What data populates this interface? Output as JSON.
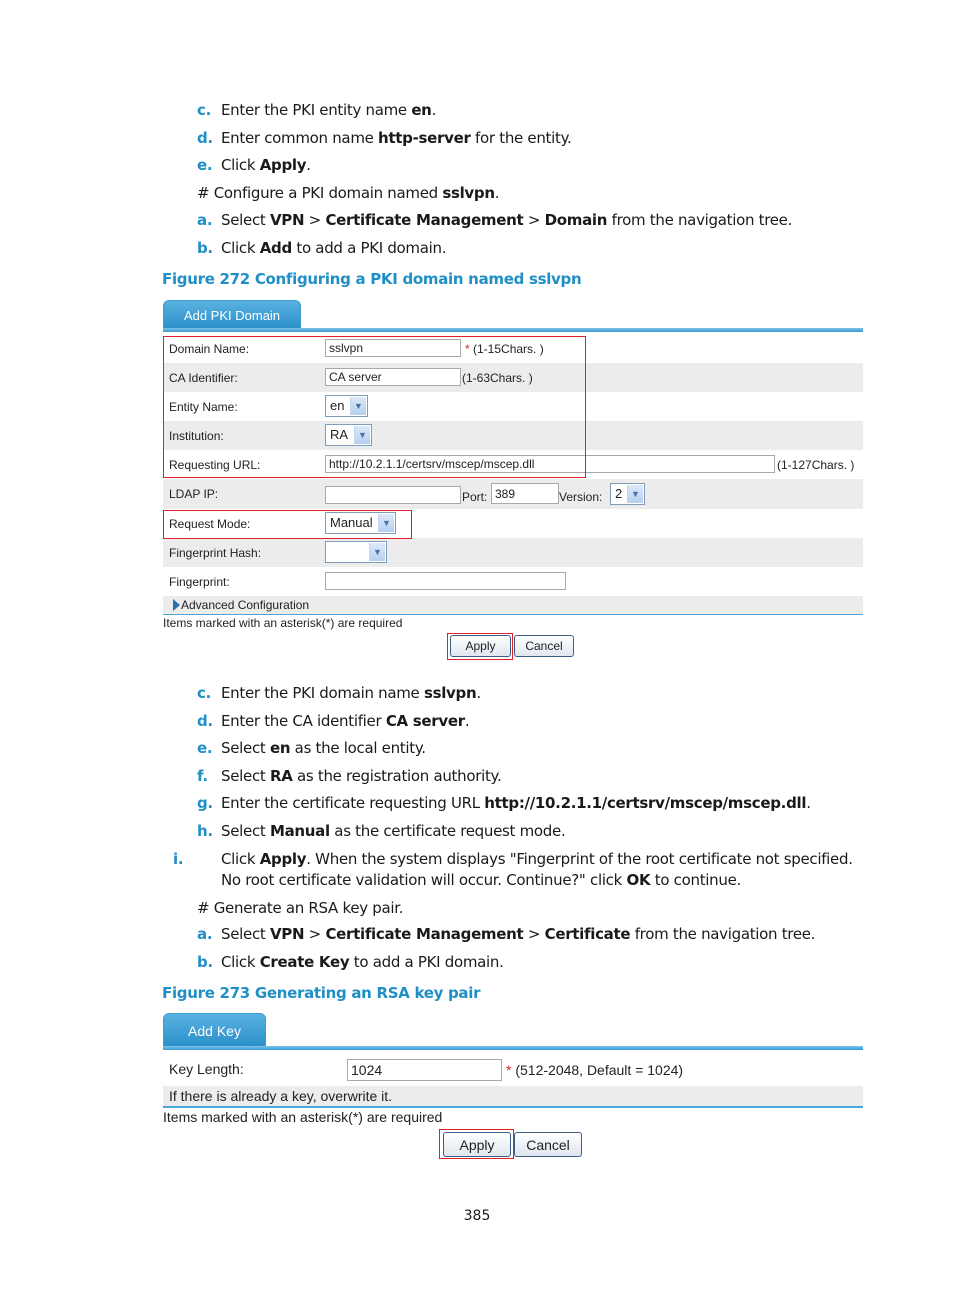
{
  "steps_top": [
    {
      "marker": "c.",
      "pre": "Enter the PKI entity name ",
      "bold": "en",
      "post": "."
    },
    {
      "marker": "d.",
      "pre": "Enter common name ",
      "bold": "http-server",
      "post": " for the entity."
    },
    {
      "marker": "e.",
      "pre": "Click ",
      "bold": "Apply",
      "post": "."
    }
  ],
  "comment_domain": {
    "pre": "# Configure a PKI domain named ",
    "bold": "sslvpn",
    "post": "."
  },
  "steps_domain_nav": [
    {
      "marker": "a.",
      "t1": "Select ",
      "b1": "VPN",
      "t2": " > ",
      "b2": "Certificate Management",
      "t3": " > ",
      "b3": "Domain",
      "t4": " from the navigation tree."
    },
    {
      "marker": "b.",
      "pre": "Click ",
      "bold": "Add",
      "post": " to add a PKI domain."
    }
  ],
  "figure272": {
    "caption": "Figure 272 Configuring a PKI domain named sslvpn",
    "tab_label": "Add PKI Domain",
    "domain_name": {
      "label": "Domain Name:",
      "value": "sslvpn",
      "required_mark": "*",
      "hint": "(1-15Chars. )"
    },
    "ca_identifier": {
      "label": "CA Identifier:",
      "value": "CA server",
      "hint": "(1-63Chars. )"
    },
    "entity_name": {
      "label": "Entity Name:",
      "value": "en"
    },
    "institution": {
      "label": "Institution:",
      "value": "RA"
    },
    "requesting_url": {
      "label": "Requesting URL:",
      "value": "http://10.2.1.1/certsrv/mscep/mscep.dll",
      "hint": "(1-127Chars. )"
    },
    "ldap": {
      "label": "LDAP IP:",
      "value": "",
      "port_label": "Port:",
      "port_value": "389",
      "version_label": "Version:",
      "version_value": "2"
    },
    "request_mode": {
      "label": "Request Mode:",
      "value": "Manual"
    },
    "fingerprint_hash": {
      "label": "Fingerprint Hash:",
      "value": ""
    },
    "fingerprint": {
      "label": "Fingerprint:",
      "value": ""
    },
    "advanced": "Advanced Configuration",
    "required_note": "Items marked with an asterisk(*) are required",
    "apply": "Apply",
    "cancel": "Cancel"
  },
  "steps_domain_detail": [
    {
      "marker": "c.",
      "pre": "Enter the PKI domain name ",
      "bold": "sslvpn",
      "post": "."
    },
    {
      "marker": "d.",
      "pre": "Enter the CA identifier ",
      "bold": "CA server",
      "post": "."
    },
    {
      "marker": "e.",
      "pre": "Select ",
      "bold": "en",
      "post": " as the local entity."
    },
    {
      "marker": "f.",
      "pre": "Select ",
      "bold": "RA",
      "post": " as the registration authority."
    },
    {
      "marker": "g.",
      "pre": "Enter the certificate requesting URL ",
      "bold": "http://10.2.1.1/certsrv/mscep/mscep.dll",
      "post": "."
    },
    {
      "marker": "h.",
      "pre": "Select ",
      "bold": "Manual",
      "post": " as the certificate request mode."
    },
    {
      "marker": "i.",
      "pre": "Click ",
      "bold": "Apply",
      "mid": ". When the system displays \"Fingerprint of the root certificate not specified. No root certificate validation will occur. Continue?\" click ",
      "bold2": "OK",
      "post": " to continue."
    }
  ],
  "comment_rsa": "# Generate an RSA key pair.",
  "steps_rsa": [
    {
      "marker": "a.",
      "t1": "Select ",
      "b1": "VPN",
      "t2": " > ",
      "b2": "Certificate Management",
      "t3": " > ",
      "b3": "Certificate",
      "t4": " from the navigation tree."
    },
    {
      "marker": "b.",
      "pre": "Click ",
      "bold": "Create Key",
      "post": " to add a PKI domain."
    }
  ],
  "figure273": {
    "caption": "Figure 273 Generating an RSA key pair",
    "tab_label": "Add Key",
    "key_length": {
      "label": "Key Length:",
      "value": "1024",
      "required_mark": "*",
      "hint": "(512-2048, Default = 1024)"
    },
    "overwrite_note": "If there is already a key, overwrite it.",
    "required_note": "Items marked with an asterisk(*) are required",
    "apply": "Apply",
    "cancel": "Cancel"
  },
  "page_number": "385"
}
